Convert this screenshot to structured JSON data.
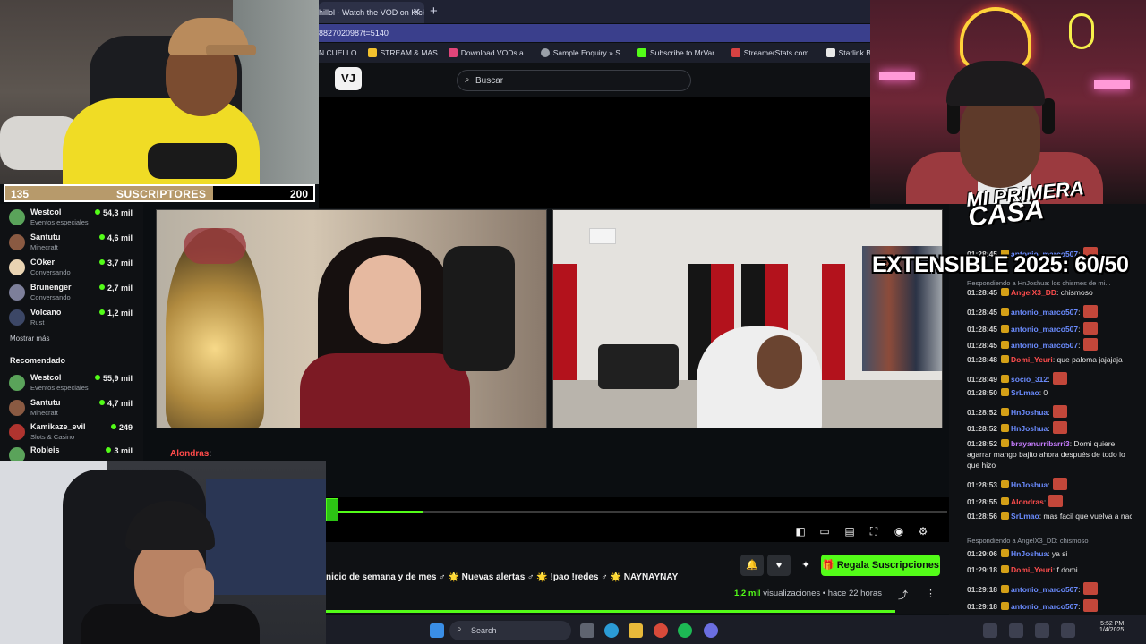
{
  "browser": {
    "tab_title": "hillol - Watch the VOD on Kick",
    "url": "8827020987t=5140",
    "bookmarks": [
      "N CUELLO",
      "STREAM & MAS",
      "Download VODs a...",
      "Sample Enquiry » S...",
      "Subscribe to MrVar...",
      "StreamerStats.com...",
      "Starlink Battery Po..."
    ]
  },
  "site": {
    "logo": "VJ",
    "search_placeholder": "Buscar"
  },
  "sub_goal": {
    "current": "135",
    "label": "SUSCRIPTORES",
    "target": "200",
    "progress": 0.675
  },
  "sidebar": {
    "following": [
      {
        "name": "Westcol",
        "category": "Eventos especiales",
        "viewers": "54,3 mil"
      },
      {
        "name": "Santutu",
        "category": "Minecraft",
        "viewers": "4,6 mil"
      },
      {
        "name": "COker",
        "category": "Conversando",
        "viewers": "3,7 mil"
      },
      {
        "name": "Brunenger",
        "category": "Conversando",
        "viewers": "2,7 mil"
      },
      {
        "name": "Volcano",
        "category": "Rust",
        "viewers": "1,2 mil"
      }
    ],
    "show_more": "Mostrar más",
    "recommended_heading": "Recomendado",
    "recommended": [
      {
        "name": "Westcol",
        "category": "Eventos especiales",
        "viewers": "55,9 mil"
      },
      {
        "name": "Santutu",
        "category": "Minecraft",
        "viewers": "4,7 mil"
      },
      {
        "name": "Kamikaze_evil",
        "category": "Slots & Casino",
        "viewers": "249"
      },
      {
        "name": "Robleis",
        "category": "",
        "viewers": "3 mil"
      }
    ]
  },
  "overlay_chat": {
    "user": "Alondras",
    "text": ":"
  },
  "player": {
    "progress": 0.146
  },
  "video_info": {
    "title": "nicio de semana y de mes ♂ 🌟 Nuevas alertas ♂ 🌟 !pao !redes ♂ 🌟 NAYNAYNAY",
    "subscribe_label": "Regala Suscripciones",
    "views": "1,2 mil",
    "views_label": "visualizaciones",
    "age": "hace 22 horas"
  },
  "overlay_text": {
    "casa_line1": "MI PRIMERA",
    "casa_line2": "CASA",
    "extensible": "EXTENSIBLE 2025: 60/50"
  },
  "chat": {
    "messages": [
      {
        "time": "01:28:45",
        "user": "antonio_marco507",
        "color": "#6b8cff",
        "text": ":"
      },
      {
        "reply": "Respondiendo a HnJoshua: los chismes de mi..."
      },
      {
        "time": "01:28:45",
        "user": "AngelX3_DD",
        "color": "#ff4d4d",
        "text": ": chismoso"
      },
      {
        "time": "01:28:45",
        "user": "antonio_marco507",
        "color": "#6b8cff",
        "text": ":"
      },
      {
        "time": "01:28:45",
        "user": "antonio_marco507",
        "color": "#6b8cff",
        "text": ":"
      },
      {
        "time": "01:28:45",
        "user": "antonio_marco507",
        "color": "#6b8cff",
        "text": ":"
      },
      {
        "time": "01:28:48",
        "user": "Domi_Yeuri",
        "color": "#ff4d4d",
        "text": ": que paloma jajajaja"
      },
      {
        "time": "01:28:49",
        "user": "socio_312",
        "color": "#6b8cff",
        "text": ":"
      },
      {
        "time": "01:28:50",
        "user": "SrLmao",
        "color": "#6b8cff",
        "text": ": 0"
      },
      {
        "time": "01:28:52",
        "user": "HnJoshua",
        "color": "#6b8cff",
        "text": ":"
      },
      {
        "time": "01:28:52",
        "user": "HnJoshua",
        "color": "#6b8cff",
        "text": ":"
      },
      {
        "time": "01:28:52",
        "user": "brayanurribarri3",
        "color": "#c77dff",
        "text": ": Domi quiere agarrar mango bajito ahora después de todo lo que hizo"
      },
      {
        "time": "01:28:53",
        "user": "HnJoshua",
        "color": "#6b8cff",
        "text": ":"
      },
      {
        "time": "01:28:55",
        "user": "Alondras",
        "color": "#ff4d4d",
        "text": ":"
      },
      {
        "time": "01:28:56",
        "user": "SrLmao",
        "color": "#6b8cff",
        "text": ": mas facil que vuelva a nacer"
      },
      {
        "reply": "Respondiendo a AngelX3_DD: chismoso"
      },
      {
        "time": "01:29:06",
        "user": "HnJoshua",
        "color": "#6b8cff",
        "text": ": ya si"
      },
      {
        "time": "01:29:18",
        "user": "Domi_Yeuri",
        "color": "#ff4d4d",
        "text": ": f domi"
      },
      {
        "time": "01:29:18",
        "user": "antonio_marco507",
        "color": "#6b8cff",
        "text": ":"
      },
      {
        "time": "01:29:18",
        "user": "antonio_marco507",
        "color": "#6b8cff",
        "text": ":"
      }
    ]
  },
  "taskbar": {
    "search": "Search",
    "time": "5:52 PM",
    "date": "1/4/2025"
  },
  "colors": {
    "accent": "#53fc18",
    "bg": "#0b0e11"
  }
}
